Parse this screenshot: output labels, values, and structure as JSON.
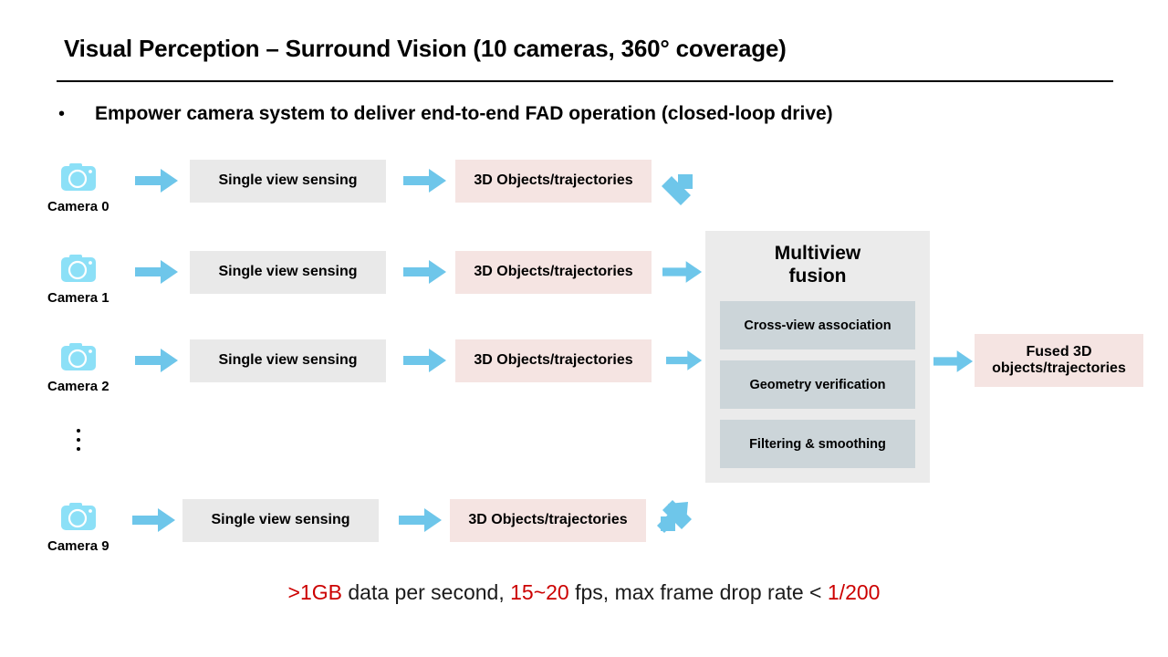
{
  "slide": {
    "title": "Visual Perception – Surround Vision (10 cameras, 360° coverage)",
    "bullet_marker": "•",
    "bullet_text": "Empower camera system to deliver end-to-end FAD operation (closed-loop drive)"
  },
  "pipeline": {
    "rows": [
      {
        "camera_label": "Camera 0",
        "stage1": "Single view sensing",
        "stage2": "3D Objects/trajectories"
      },
      {
        "camera_label": "Camera 1",
        "stage1": "Single view sensing",
        "stage2": "3D Objects/trajectories"
      },
      {
        "camera_label": "Camera 2",
        "stage1": "Single view sensing",
        "stage2": "3D Objects/trajectories"
      },
      {
        "camera_label": "Camera 9",
        "stage1": "Single view sensing",
        "stage2": "3D Objects/trajectories"
      }
    ],
    "ellipsis": "⋮"
  },
  "fusion": {
    "title_line1": "Multiview",
    "title_line2": "fusion",
    "steps": [
      "Cross-view association",
      "Geometry verification",
      "Filtering & smoothing"
    ]
  },
  "output": {
    "line1": "Fused 3D",
    "line2": "objects/trajectories"
  },
  "footer": {
    "part1": ">1GB",
    "part2": " data per second, ",
    "part3": "15~20",
    "part4": " fps, max frame drop rate < ",
    "part5": "1/200"
  },
  "colors": {
    "accent_arrow": "#6ec6ea",
    "camera_icon": "#8ce0f7",
    "box_gray": "#e9e9e9",
    "box_pink": "#f5e4e2",
    "fusion_bg": "#ebebeb",
    "fusion_step": "#ccd5d9",
    "highlight_red": "#cc0000"
  }
}
